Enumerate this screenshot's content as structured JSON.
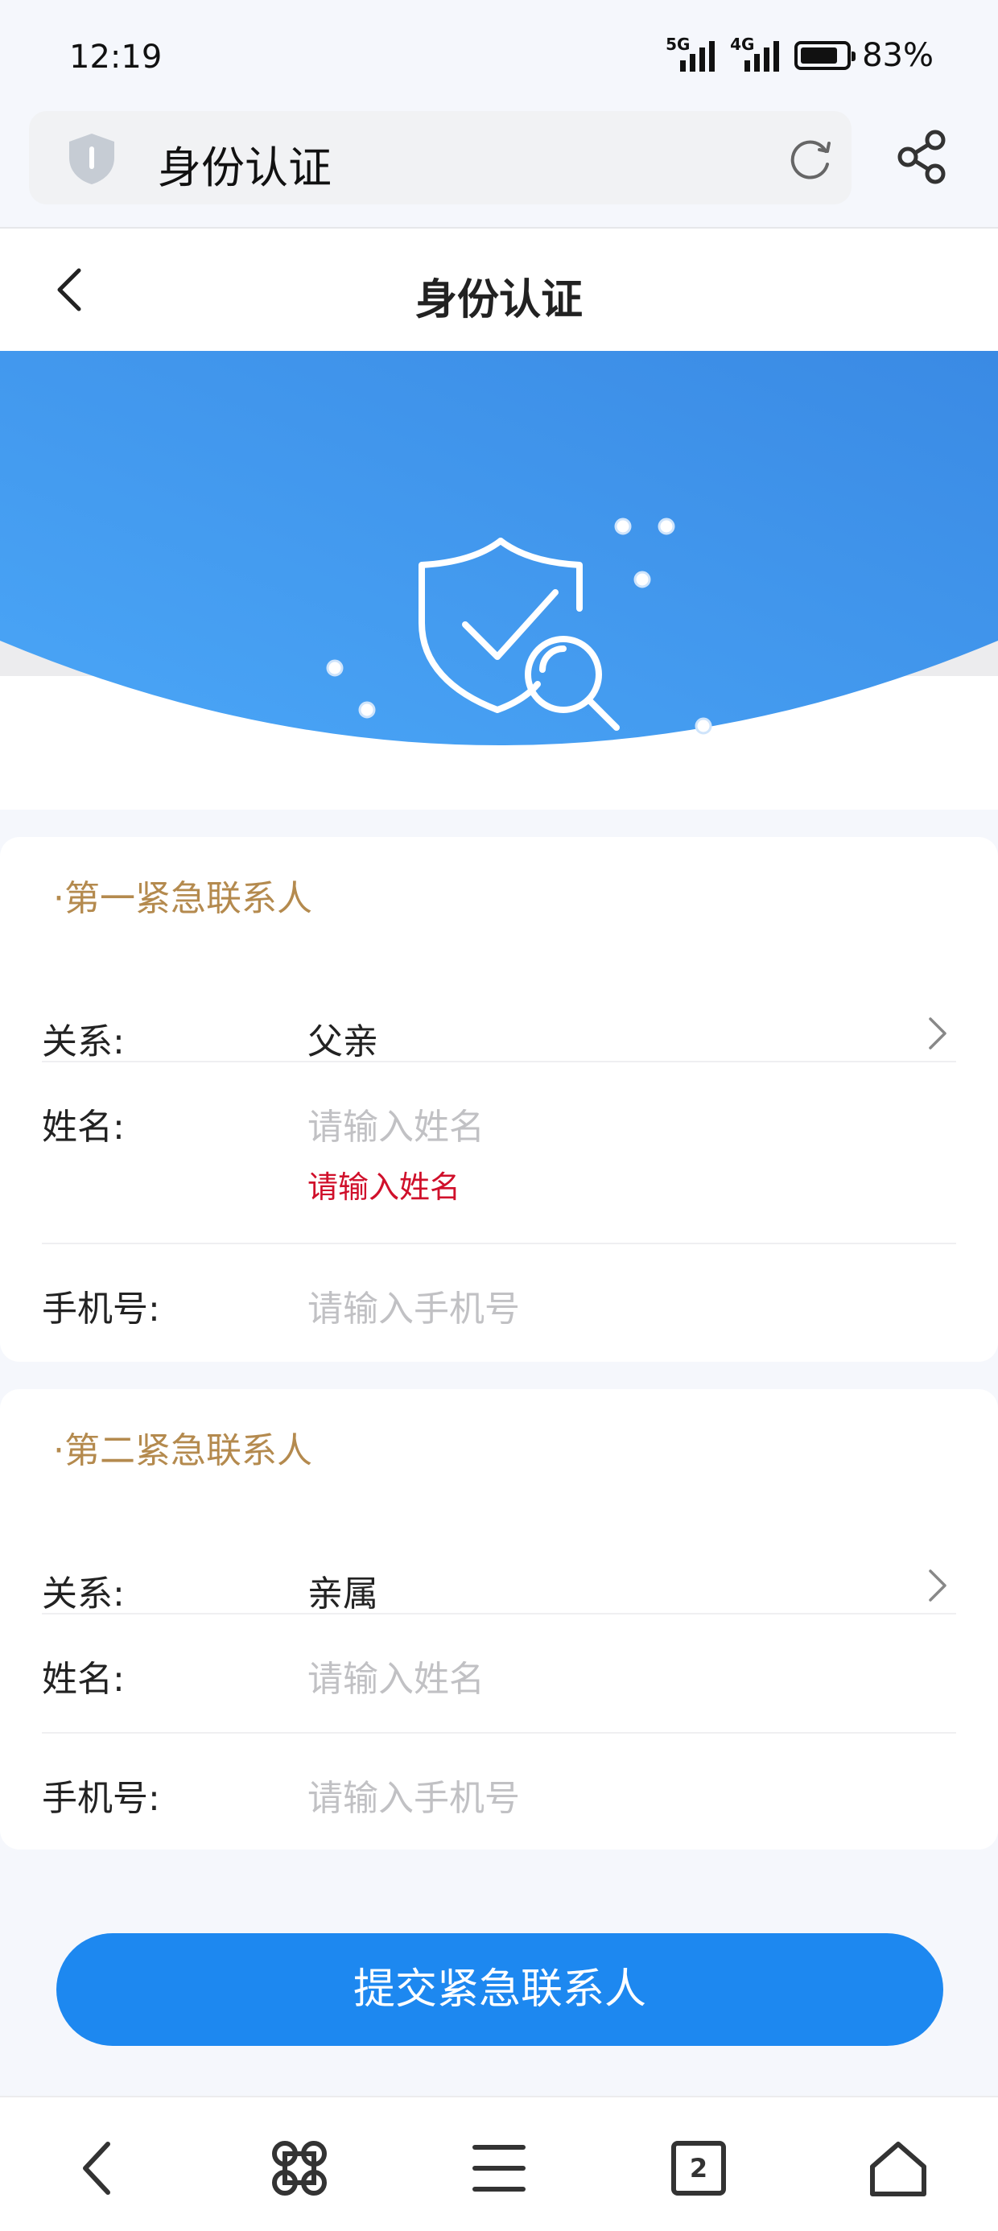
{
  "status_bar": {
    "time": "12:19",
    "network_1": "5G",
    "network_2": "4G",
    "battery": "83%"
  },
  "browser": {
    "address_title": "身份认证",
    "tab_count": "2"
  },
  "header": {
    "title": "身份认证"
  },
  "colors": {
    "accent": "#1d88f0",
    "section_title": "#b48a4e",
    "error": "#d0102b",
    "placeholder": "#c1c1c4"
  },
  "section1": {
    "title": "·第一紧急联系人",
    "relation_label": "关系:",
    "relation_value": "父亲",
    "name_label": "姓名:",
    "name_placeholder": "请输入姓名",
    "name_error": "请输入姓名",
    "phone_label": "手机号:",
    "phone_placeholder": "请输入手机号"
  },
  "section2": {
    "title": "·第二紧急联系人",
    "relation_label": "关系:",
    "relation_value": "亲属",
    "name_label": "姓名:",
    "name_placeholder": "请输入姓名",
    "phone_label": "手机号:",
    "phone_placeholder": "请输入手机号"
  },
  "submit_label": "提交紧急联系人",
  "icons": [
    "shield-icon",
    "reload-icon",
    "share-icon",
    "back-icon",
    "chevron-right-icon",
    "shield-check-search-icon",
    "nav-back-icon",
    "nav-apps-icon",
    "nav-menu-icon",
    "nav-tabs-icon",
    "nav-home-icon"
  ]
}
